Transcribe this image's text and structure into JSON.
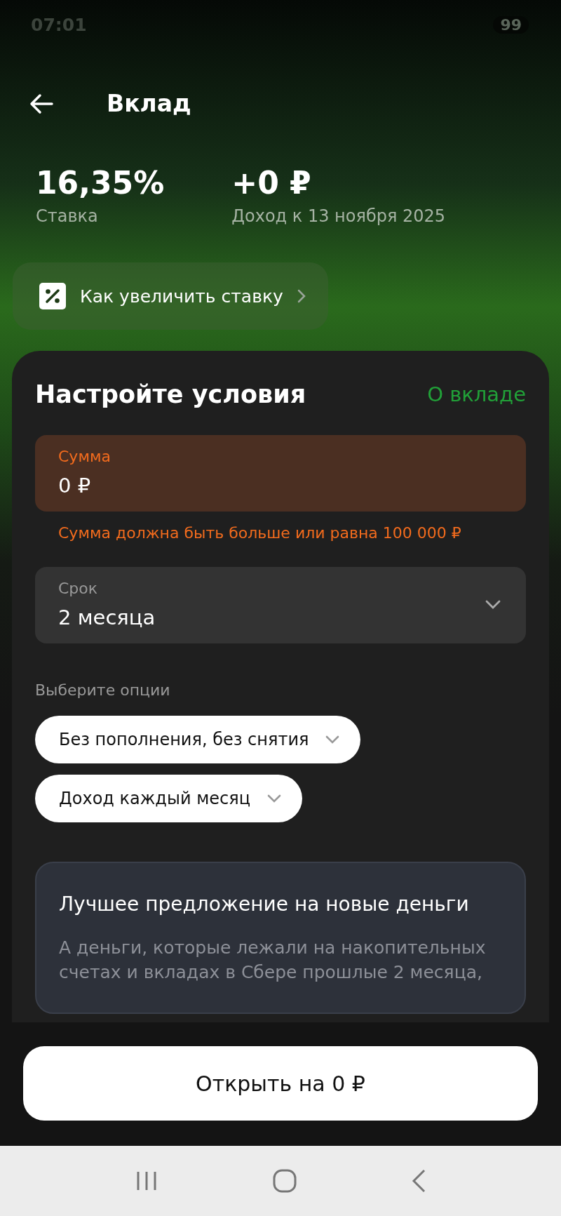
{
  "status_bar": {
    "time": "07:01",
    "battery": "99"
  },
  "header": {
    "title": "Вклад"
  },
  "stats": [
    {
      "value": "16,35%",
      "label": "Ставка"
    },
    {
      "value": "+0 ₽",
      "label": "Доход к 13 ноября 2025"
    }
  ],
  "promo_chip": {
    "label": "Как увеличить ставку"
  },
  "conditions": {
    "title": "Настройте условия",
    "link": "О вкладе",
    "amount": {
      "label": "Сумма",
      "value": "0 ₽",
      "error": "Сумма должна быть больше или равна 100 000 ₽"
    },
    "term": {
      "label": "Срок",
      "value": "2 месяца"
    },
    "options_label": "Выберите опции",
    "options": [
      {
        "label": "Без пополнения, без снятия"
      },
      {
        "label": "Доход каждый месяц"
      }
    ],
    "offer": {
      "title": "Лучшее предложение на новые деньги",
      "text": "А деньги, которые лежали на накопительных счетах и вкладах в Сбере прошлые 2 месяца,"
    }
  },
  "primary_button": {
    "label": "Открыть на 0 ₽"
  }
}
